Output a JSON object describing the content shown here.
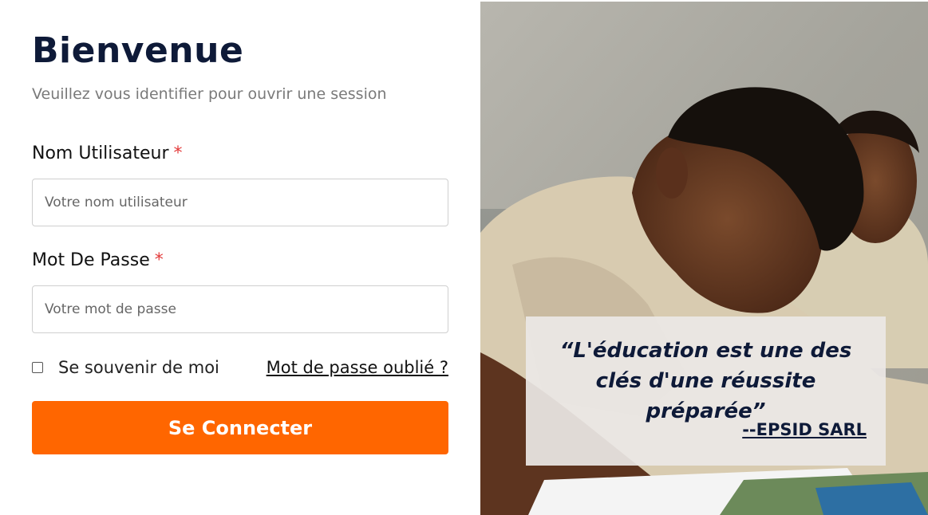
{
  "login": {
    "title": "Bienvenue",
    "subtitle": "Veuillez vous identifier pour ouvrir une session",
    "username": {
      "label": "Nom Utilisateur",
      "required_mark": "*",
      "placeholder": "Votre nom utilisateur",
      "value": ""
    },
    "password": {
      "label": "Mot De Passe",
      "required_mark": "*",
      "placeholder": "Votre mot de passe",
      "value": ""
    },
    "remember_me": {
      "label": "Se souvenir de moi",
      "checked": false
    },
    "forgot_password": "Mot de passe oublié ?",
    "submit_label": "Se Connecter"
  },
  "hero": {
    "quote": "“L'éducation est une des clés d'une réussite préparée”",
    "author": "--EPSID SARL"
  },
  "colors": {
    "primary_button": "#ff6600",
    "heading": "#0e1a38",
    "required": "#e33a3a"
  }
}
